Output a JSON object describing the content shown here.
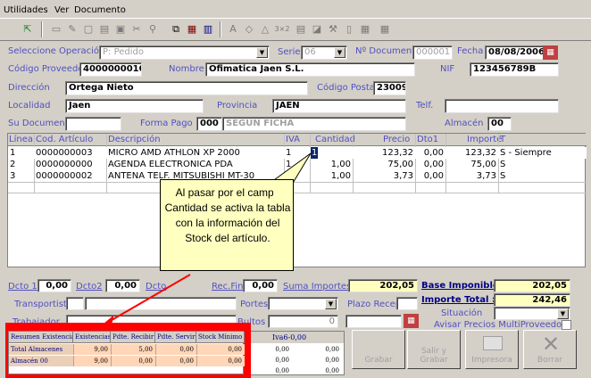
{
  "menu": {
    "items": [
      "Utilidades",
      "Ver",
      "Documento"
    ]
  },
  "header": {
    "op_label": "Seleccione Operación",
    "op_value": "P: Pedido",
    "serie_label": "Serie",
    "serie_value": "06",
    "ndoc_label": "Nº Documento",
    "ndoc_value": "000001",
    "fecha_label": "Fecha",
    "fecha_value": "08/08/2006",
    "codprov_label": "Código Proveedor",
    "codprov_value": "40000000101",
    "nombre_label": "Nombre",
    "nombre_value": "Ofimatica Jaen S.L.",
    "nif_label": "NIF",
    "nif_value": "123456789B",
    "direccion_label": "Dirección",
    "direccion_value": "Ortega Nieto",
    "cp_label": "Código Postal",
    "cp_value": "23009",
    "localidad_label": "Localidad",
    "localidad_value": "Jaen",
    "provincia_label": "Provincia",
    "provincia_value": "JAEN",
    "telf_label": "Telf.",
    "telf_value": "",
    "sudoc_label": "Su Documento",
    "sudoc_value": "",
    "formapago_label": "Forma Pago",
    "formapago_code": "000",
    "formapago_value": "SEGUN FICHA",
    "almacen_label": "Almacén",
    "almacen_value": "00"
  },
  "grid": {
    "columns": [
      "Línea",
      "Cod. Artículo",
      "Descripción",
      "IVA",
      "Cantidad",
      "Precio",
      "Dto1",
      "Importe",
      "T"
    ],
    "rows": [
      {
        "linea": "1",
        "cod": "0000000003",
        "desc": "MICRO AMD ATHLON XP 2000",
        "iva": "1",
        "cantidad": "1",
        "precio": "123,32",
        "dto1": "0,00",
        "importe": "123,32",
        "t": "S - Siempre"
      },
      {
        "linea": "2",
        "cod": "0000000000",
        "desc": "AGENDA ELECTRONICA PDA",
        "iva": "1",
        "cantidad": "1,00",
        "precio": "75,00",
        "dto1": "0,00",
        "importe": "75,00",
        "t": "S"
      },
      {
        "linea": "3",
        "cod": "0000000002",
        "desc": "ANTENA TELF. MITSUBISHI MT-30",
        "iva": "1",
        "cantidad": "1,00",
        "precio": "3,73",
        "dto1": "0,00",
        "importe": "3,73",
        "t": "S"
      }
    ]
  },
  "callout": {
    "text": "Al pasar por el campo Cantidad se activa la tabla con la información del Stock del artículo."
  },
  "footer": {
    "dcto1_label": "Dcto 1",
    "dcto1_value": "0,00",
    "dcto2_label": "Dcto2",
    "dcto2_value": "0,00",
    "dcto3_label": "Dcto",
    "recfin_label": "Rec.Fin",
    "recfin_value": "0,00",
    "suma_label": "Suma Importes",
    "suma_value": "202,05",
    "base_label": "Base Imponible",
    "base_value": "202,05",
    "total_label": "Importe Total :",
    "total_value": "242,46",
    "transportista_label": "Transportista",
    "portes_label": "Portes",
    "plazo_label": "Plazo Recep.",
    "situacion_label": "Situación",
    "trabajador_label": "Trabajador",
    "bultos_label": "Bultos",
    "bultos_value": "0",
    "avisar_label": "Avisar Precios MultiProveedor",
    "iva_label": "Iva6-0,00",
    "iva_values": [
      "0,00",
      "0,00",
      "0,00",
      "0,00",
      "0,00",
      "0,00"
    ]
  },
  "stock": {
    "headers": [
      "Resumen Existencias",
      "Existencias",
      "Pdte. Recibir",
      "Pdte. Servir",
      "Stock Mínimo"
    ],
    "rows": [
      {
        "label": "Total Almacenes",
        "values": [
          "9,00",
          "5,00",
          "0,00",
          "0,00"
        ]
      },
      {
        "label": "Almacén 00",
        "values": [
          "9,00",
          "0,00",
          "0,00",
          "0,00"
        ]
      }
    ]
  },
  "buttons": {
    "grabar": "Grabar",
    "salir": "Salir y Grabar",
    "impresora": "Impresora",
    "borrar": "Borrar"
  },
  "colors": {
    "label_blue": "#5050c0",
    "highlight_red": "#ff0000",
    "stock_fill": "#ffd6b8",
    "callout_fill": "#ffffc0"
  }
}
